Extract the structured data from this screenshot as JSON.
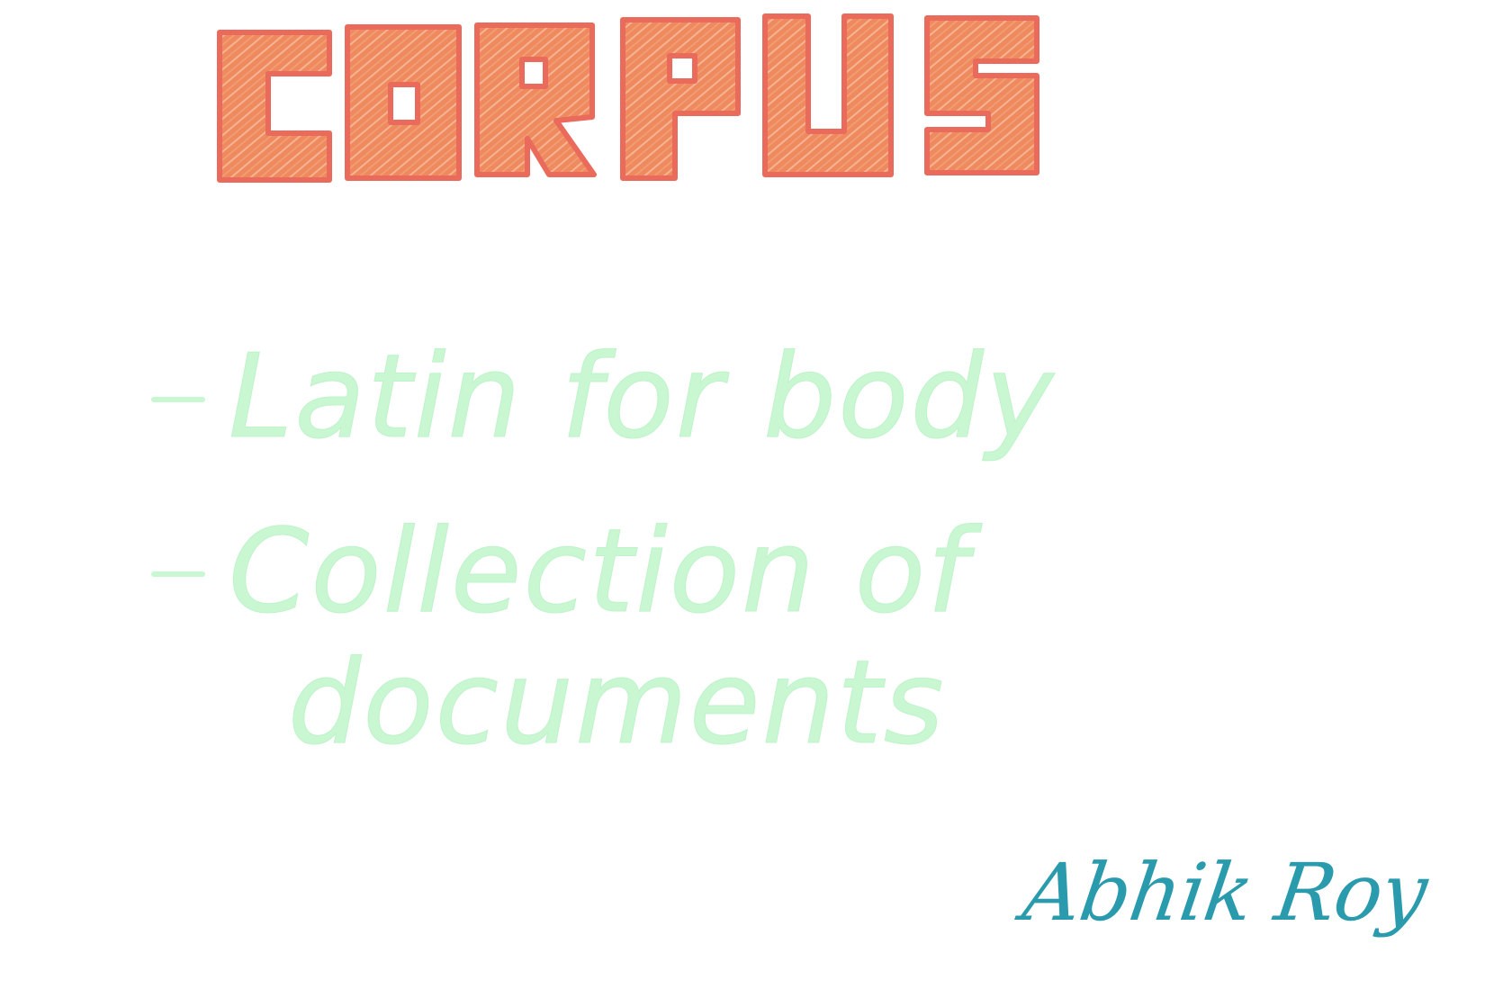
{
  "title": {
    "text": "CORPUS",
    "fill_color": "#ee8a5e",
    "outline_color": "#ea6a5c"
  },
  "bullets": [
    {
      "text": "Latin for body"
    },
    {
      "text": "Collection of",
      "continuation": "documents"
    }
  ],
  "bullet_color": "#c8f7d2",
  "signature": {
    "text": "Abhik Roy",
    "color": "#2a9aad"
  }
}
